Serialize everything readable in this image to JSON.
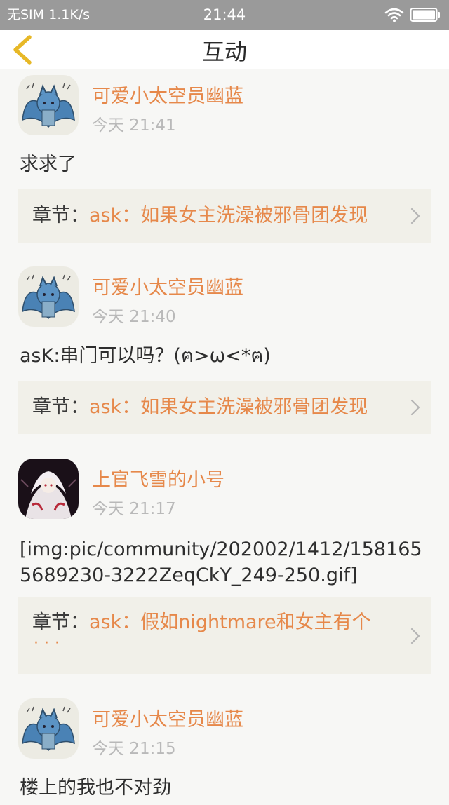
{
  "status_bar": {
    "carrier": "无SIM",
    "speed": "1.1K/s",
    "time": "21:44"
  },
  "header": {
    "title": "互动",
    "back_icon": "chevron-left-icon"
  },
  "posts": [
    {
      "user": "可爱小太空员幽蓝",
      "time": "今天 21:41",
      "content": "求求了",
      "chapter_prefix": "章节：",
      "chapter_title": "ask：如果女主洗澡被邪骨团发现"
    },
    {
      "user": "可爱小太空员幽蓝",
      "time": "今天 21:40",
      "content": "asK:串门可以吗？(ฅ>ω<*ฅ)",
      "chapter_prefix": "章节：",
      "chapter_title": "ask：如果女主洗澡被邪骨团发现"
    },
    {
      "user": "上官飞雪的小号",
      "time": "今天 21:17",
      "content": "[img:pic/community/202002/1412/1581655689230-3222ZeqCkY_249-250.gif]",
      "chapter_prefix": "章节：",
      "chapter_title": "ask：假如nightmare和女主有个",
      "chapter_more": "···"
    },
    {
      "user": "可爱小太空员幽蓝",
      "time": "今天 21:15",
      "content": "楼上的我也不对劲"
    }
  ],
  "colors": {
    "accent": "#e6884a",
    "status_bar": "#9a9a9a",
    "background": "#f7f7f5",
    "chapter_bg": "#f1f0e9"
  }
}
